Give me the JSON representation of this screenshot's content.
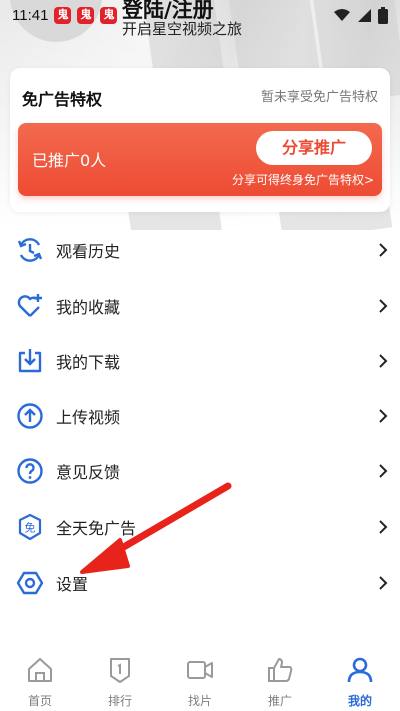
{
  "status_bar": {
    "time": "11:41",
    "notif_icons": [
      "app-notification-icon",
      "app-notification-icon",
      "app-notification-icon"
    ],
    "right_icons": [
      "wifi-icon",
      "signal-icon",
      "battery-icon"
    ]
  },
  "user": {
    "login_label": "登陆/注册",
    "tagline": "开启星空视频之旅"
  },
  "adfree": {
    "title": "免广告特权",
    "status": "暂未享受免广告特权",
    "promo_count": "已推广0人",
    "share_button": "分享推广",
    "share_hint": "分享可得终身免广告特权>",
    "colors": {
      "promo_start": "#f26a4e",
      "promo_end": "#ee4b33"
    }
  },
  "menu": {
    "items": [
      {
        "label": "观看历史",
        "icon": "history-icon"
      },
      {
        "label": "我的收藏",
        "icon": "favorite-heart-icon"
      },
      {
        "label": "我的下载",
        "icon": "download-icon"
      },
      {
        "label": "上传视频",
        "icon": "upload-icon"
      },
      {
        "label": "意见反馈",
        "icon": "feedback-question-icon"
      },
      {
        "label": "全天免广告",
        "icon": "ad-free-badge-icon"
      },
      {
        "label": "设置",
        "icon": "settings-hexagon-icon"
      }
    ],
    "icon_color": "#2b6bd8"
  },
  "tabs": [
    {
      "label": "首页",
      "icon": "home-icon",
      "active": false
    },
    {
      "label": "排行",
      "icon": "ranking-icon",
      "active": false
    },
    {
      "label": "找片",
      "icon": "video-camera-icon",
      "active": false
    },
    {
      "label": "推广",
      "icon": "thumbs-up-icon",
      "active": false
    },
    {
      "label": "我的",
      "icon": "profile-icon",
      "active": true
    }
  ],
  "annotation": {
    "arrow_color": "#e8231b"
  }
}
